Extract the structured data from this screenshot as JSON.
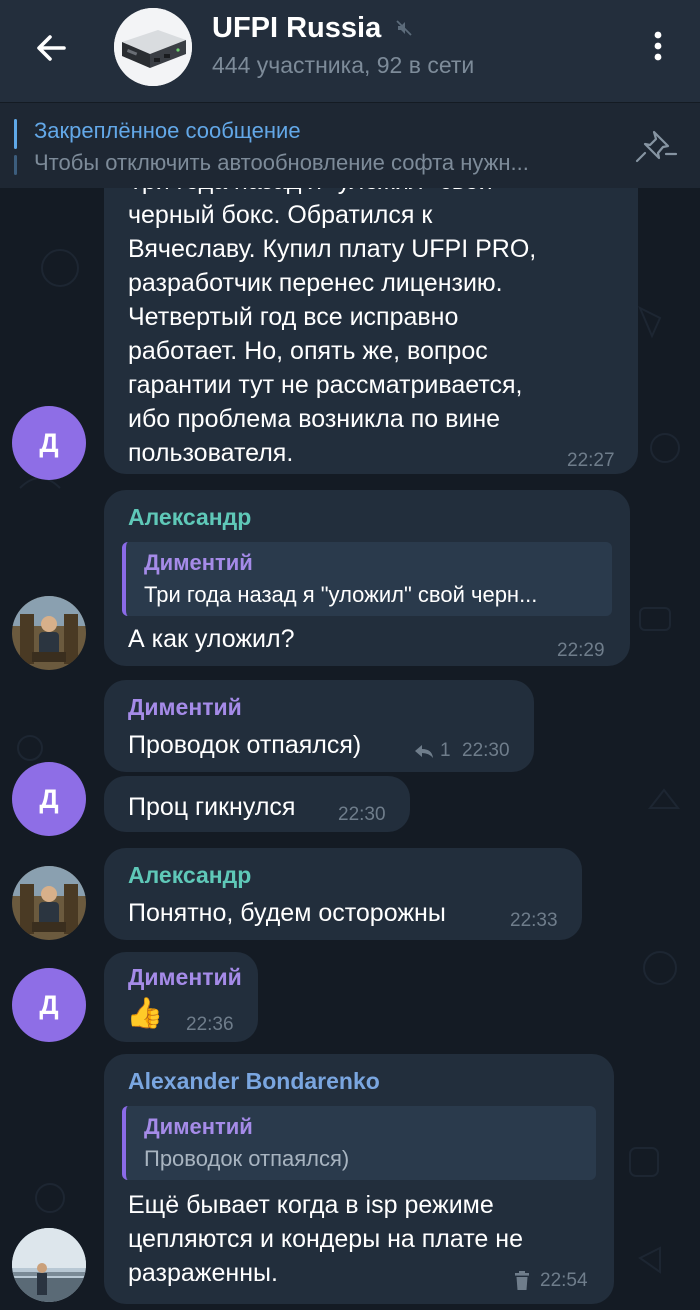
{
  "header": {
    "title": "UFPI Russia",
    "subtitle": "444 участника, 92 в сети"
  },
  "pinned": {
    "title": "Закреплённое сообщение",
    "text": "Чтобы отключить автообновление софта нужн..."
  },
  "messages": [
    {
      "lines": [
        "Три года назад я \"уложил\" свой",
        "черный бокс. Обратился к",
        "Вячеславу. Купил плату UFPI PRO,",
        "разработчик перенес лицензию.",
        "Четвертый год все исправно",
        "работает. Но, опять же, вопрос",
        "гарантии тут не рассматривается,",
        "ибо проблема возникла по вине",
        "пользователя."
      ],
      "time": "22:27",
      "avatar_letter": "Д"
    },
    {
      "sender": "Александр",
      "reply_name": "Диментий",
      "reply_text": "Три года назад я \"уложил\" свой черн...",
      "text": "А как уложил?",
      "time": "22:29"
    },
    {
      "sender": "Диментий",
      "text": "Проводок отпаялся)",
      "replies_count": "1",
      "time": "22:30"
    },
    {
      "text": "Проц гикнулся",
      "time": "22:30",
      "avatar_letter": "Д"
    },
    {
      "sender": "Александр",
      "text": "Понятно, будем осторожны",
      "time": "22:33"
    },
    {
      "sender": "Диментий",
      "text": "👍",
      "time": "22:36",
      "avatar_letter": "Д"
    },
    {
      "sender": "Alexander Bondarenko",
      "reply_name": "Диментий",
      "reply_text": "Проводок отпаялся)",
      "lines": [
        "Ещё бывает когда в isp режиме",
        "цепляются и кондеры на плате  не",
        "разраженны."
      ],
      "time": "22:54"
    }
  ],
  "colors": {
    "header_bg": "#232e3c",
    "bubble_bg": "#222e3c",
    "accent_blue": "#63a8e8",
    "name_teal": "#5fc8b8",
    "name_purple": "#a58be8",
    "name_blue": "#7aa6e0",
    "avatar_purple": "#8e6ee6"
  }
}
